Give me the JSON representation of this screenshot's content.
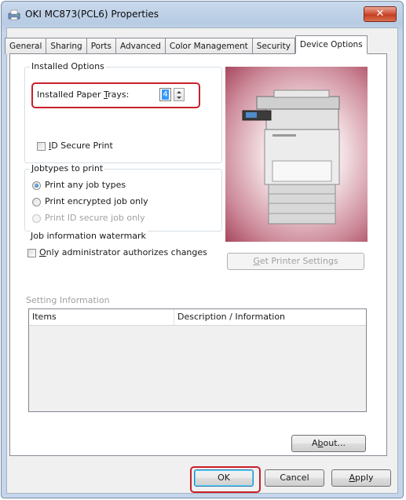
{
  "window": {
    "title": "OKI MC873(PCL6) Properties",
    "close_glyph": "✕"
  },
  "tabs": [
    {
      "label": "General",
      "active": false
    },
    {
      "label": "Sharing",
      "active": false
    },
    {
      "label": "Ports",
      "active": false
    },
    {
      "label": "Advanced",
      "active": false
    },
    {
      "label": "Color Management",
      "active": false
    },
    {
      "label": "Security",
      "active": false
    },
    {
      "label": "Device Options",
      "active": true
    }
  ],
  "installed_options": {
    "legend": "Installed Options",
    "paper_trays_label_pre": "Installed Paper ",
    "paper_trays_label_key": "T",
    "paper_trays_label_post": "rays:",
    "paper_trays_value": "4",
    "id_secure_print_key": "I",
    "id_secure_print_rest": "D Secure Print",
    "id_secure_print_checked": false
  },
  "jobtypes": {
    "legend_key": "J",
    "legend_rest": "obtypes to print",
    "options": [
      {
        "label": "Print any job types",
        "checked": true,
        "disabled": false
      },
      {
        "label": "Print encrypted job only",
        "checked": false,
        "disabled": false
      },
      {
        "label": "Print ID secure job only",
        "checked": false,
        "disabled": true
      }
    ]
  },
  "watermark": {
    "legend": "Job information watermark",
    "checkbox_key": "O",
    "checkbox_rest": "nly administrator authorizes changes",
    "checked": false
  },
  "get_printer_settings": {
    "key": "G",
    "rest": "et Printer Settings"
  },
  "setting_information": {
    "label": "Setting Information",
    "columns": [
      "Items",
      "Description / Information"
    ]
  },
  "about_button": {
    "pre": "A",
    "key": "b",
    "post": "out..."
  },
  "footer": {
    "ok": "OK",
    "cancel": "Cancel",
    "apply_key": "A",
    "apply_rest": "pply"
  },
  "colors": {
    "highlight": "#c8202a",
    "selection": "#3399ff"
  }
}
